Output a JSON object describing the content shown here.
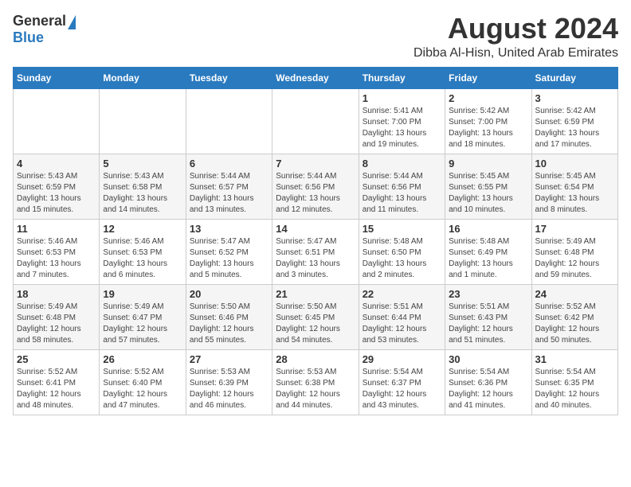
{
  "logo": {
    "general": "General",
    "blue": "Blue"
  },
  "header": {
    "title": "August 2024",
    "subtitle": "Dibba Al-Hisn, United Arab Emirates"
  },
  "days_of_week": [
    "Sunday",
    "Monday",
    "Tuesday",
    "Wednesday",
    "Thursday",
    "Friday",
    "Saturday"
  ],
  "weeks": [
    [
      {
        "day": "",
        "details": ""
      },
      {
        "day": "",
        "details": ""
      },
      {
        "day": "",
        "details": ""
      },
      {
        "day": "",
        "details": ""
      },
      {
        "day": "1",
        "details": "Sunrise: 5:41 AM\nSunset: 7:00 PM\nDaylight: 13 hours\nand 19 minutes."
      },
      {
        "day": "2",
        "details": "Sunrise: 5:42 AM\nSunset: 7:00 PM\nDaylight: 13 hours\nand 18 minutes."
      },
      {
        "day": "3",
        "details": "Sunrise: 5:42 AM\nSunset: 6:59 PM\nDaylight: 13 hours\nand 17 minutes."
      }
    ],
    [
      {
        "day": "4",
        "details": "Sunrise: 5:43 AM\nSunset: 6:59 PM\nDaylight: 13 hours\nand 15 minutes."
      },
      {
        "day": "5",
        "details": "Sunrise: 5:43 AM\nSunset: 6:58 PM\nDaylight: 13 hours\nand 14 minutes."
      },
      {
        "day": "6",
        "details": "Sunrise: 5:44 AM\nSunset: 6:57 PM\nDaylight: 13 hours\nand 13 minutes."
      },
      {
        "day": "7",
        "details": "Sunrise: 5:44 AM\nSunset: 6:56 PM\nDaylight: 13 hours\nand 12 minutes."
      },
      {
        "day": "8",
        "details": "Sunrise: 5:44 AM\nSunset: 6:56 PM\nDaylight: 13 hours\nand 11 minutes."
      },
      {
        "day": "9",
        "details": "Sunrise: 5:45 AM\nSunset: 6:55 PM\nDaylight: 13 hours\nand 10 minutes."
      },
      {
        "day": "10",
        "details": "Sunrise: 5:45 AM\nSunset: 6:54 PM\nDaylight: 13 hours\nand 8 minutes."
      }
    ],
    [
      {
        "day": "11",
        "details": "Sunrise: 5:46 AM\nSunset: 6:53 PM\nDaylight: 13 hours\nand 7 minutes."
      },
      {
        "day": "12",
        "details": "Sunrise: 5:46 AM\nSunset: 6:53 PM\nDaylight: 13 hours\nand 6 minutes."
      },
      {
        "day": "13",
        "details": "Sunrise: 5:47 AM\nSunset: 6:52 PM\nDaylight: 13 hours\nand 5 minutes."
      },
      {
        "day": "14",
        "details": "Sunrise: 5:47 AM\nSunset: 6:51 PM\nDaylight: 13 hours\nand 3 minutes."
      },
      {
        "day": "15",
        "details": "Sunrise: 5:48 AM\nSunset: 6:50 PM\nDaylight: 13 hours\nand 2 minutes."
      },
      {
        "day": "16",
        "details": "Sunrise: 5:48 AM\nSunset: 6:49 PM\nDaylight: 13 hours\nand 1 minute."
      },
      {
        "day": "17",
        "details": "Sunrise: 5:49 AM\nSunset: 6:48 PM\nDaylight: 12 hours\nand 59 minutes."
      }
    ],
    [
      {
        "day": "18",
        "details": "Sunrise: 5:49 AM\nSunset: 6:48 PM\nDaylight: 12 hours\nand 58 minutes."
      },
      {
        "day": "19",
        "details": "Sunrise: 5:49 AM\nSunset: 6:47 PM\nDaylight: 12 hours\nand 57 minutes."
      },
      {
        "day": "20",
        "details": "Sunrise: 5:50 AM\nSunset: 6:46 PM\nDaylight: 12 hours\nand 55 minutes."
      },
      {
        "day": "21",
        "details": "Sunrise: 5:50 AM\nSunset: 6:45 PM\nDaylight: 12 hours\nand 54 minutes."
      },
      {
        "day": "22",
        "details": "Sunrise: 5:51 AM\nSunset: 6:44 PM\nDaylight: 12 hours\nand 53 minutes."
      },
      {
        "day": "23",
        "details": "Sunrise: 5:51 AM\nSunset: 6:43 PM\nDaylight: 12 hours\nand 51 minutes."
      },
      {
        "day": "24",
        "details": "Sunrise: 5:52 AM\nSunset: 6:42 PM\nDaylight: 12 hours\nand 50 minutes."
      }
    ],
    [
      {
        "day": "25",
        "details": "Sunrise: 5:52 AM\nSunset: 6:41 PM\nDaylight: 12 hours\nand 48 minutes."
      },
      {
        "day": "26",
        "details": "Sunrise: 5:52 AM\nSunset: 6:40 PM\nDaylight: 12 hours\nand 47 minutes."
      },
      {
        "day": "27",
        "details": "Sunrise: 5:53 AM\nSunset: 6:39 PM\nDaylight: 12 hours\nand 46 minutes."
      },
      {
        "day": "28",
        "details": "Sunrise: 5:53 AM\nSunset: 6:38 PM\nDaylight: 12 hours\nand 44 minutes."
      },
      {
        "day": "29",
        "details": "Sunrise: 5:54 AM\nSunset: 6:37 PM\nDaylight: 12 hours\nand 43 minutes."
      },
      {
        "day": "30",
        "details": "Sunrise: 5:54 AM\nSunset: 6:36 PM\nDaylight: 12 hours\nand 41 minutes."
      },
      {
        "day": "31",
        "details": "Sunrise: 5:54 AM\nSunset: 6:35 PM\nDaylight: 12 hours\nand 40 minutes."
      }
    ]
  ]
}
